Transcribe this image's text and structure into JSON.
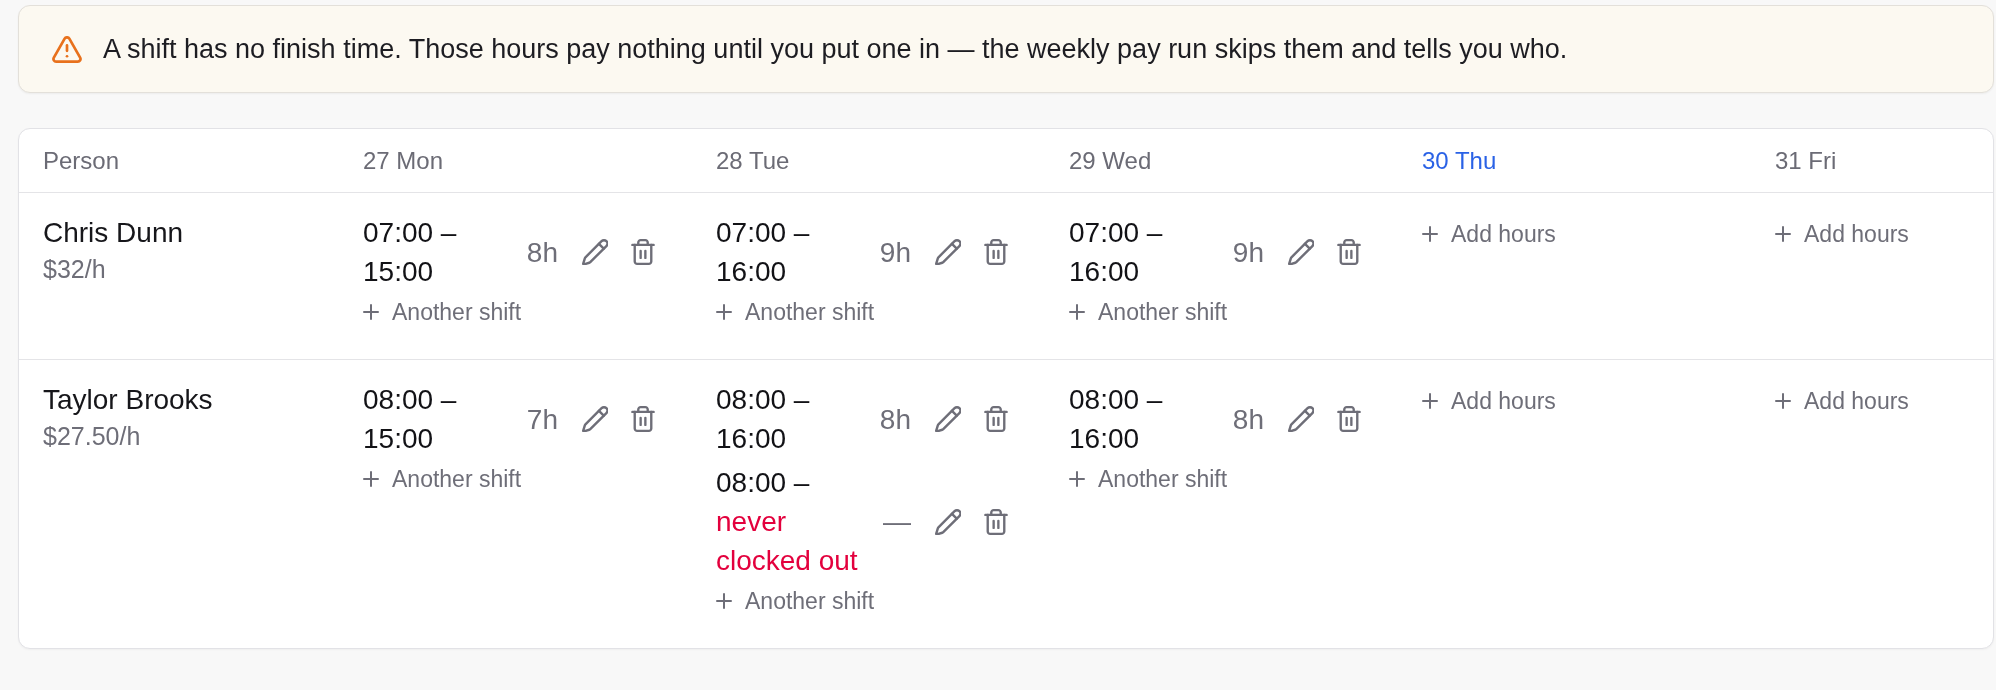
{
  "alert": {
    "text": "A shift has no finish time. Those hours pay nothing until you put one in — the weekly pay run skips them and tells you who."
  },
  "table": {
    "person_heading": "Person",
    "days": [
      {
        "label": "27 Mon",
        "today": false
      },
      {
        "label": "28 Tue",
        "today": false
      },
      {
        "label": "29 Wed",
        "today": false
      },
      {
        "label": "30 Thu",
        "today": true
      },
      {
        "label": "31 Fri",
        "today": false
      }
    ],
    "rows": [
      {
        "name": "Chris Dunn",
        "rate": "$32/h",
        "cells": [
          {
            "shifts": [
              {
                "start": "07:00 –",
                "end": "15:00",
                "clocked_out": true,
                "hours": "8h"
              }
            ],
            "action": "Another shift"
          },
          {
            "shifts": [
              {
                "start": "07:00 –",
                "end": "16:00",
                "clocked_out": true,
                "hours": "9h"
              }
            ],
            "action": "Another shift"
          },
          {
            "shifts": [
              {
                "start": "07:00 –",
                "end": "16:00",
                "clocked_out": true,
                "hours": "9h"
              }
            ],
            "action": "Another shift"
          },
          {
            "action": "Add hours"
          },
          {
            "action": "Add hours"
          }
        ]
      },
      {
        "name": "Taylor Brooks",
        "rate": "$27.50/h",
        "cells": [
          {
            "shifts": [
              {
                "start": "08:00 –",
                "end": "15:00",
                "clocked_out": true,
                "hours": "7h"
              }
            ],
            "action": "Another shift"
          },
          {
            "shifts": [
              {
                "start": "08:00 –",
                "end": "16:00",
                "clocked_out": true,
                "hours": "8h"
              },
              {
                "start": "08:00 –",
                "end": "never clocked out",
                "clocked_out": false,
                "hours": "—"
              }
            ],
            "action": "Another shift"
          },
          {
            "shifts": [
              {
                "start": "08:00 –",
                "end": "16:00",
                "clocked_out": true,
                "hours": "8h"
              }
            ],
            "action": "Another shift"
          },
          {
            "action": "Add hours"
          },
          {
            "action": "Add hours"
          }
        ]
      }
    ]
  }
}
